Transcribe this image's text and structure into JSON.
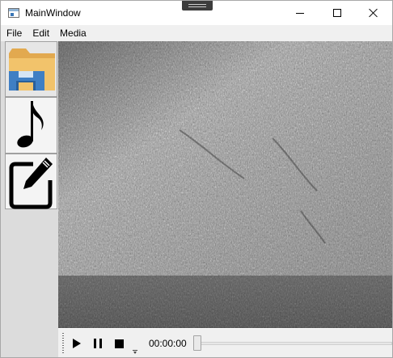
{
  "window": {
    "title": "MainWindow"
  },
  "menubar": {
    "items": [
      {
        "label": "File"
      },
      {
        "label": "Edit"
      },
      {
        "label": "Media"
      }
    ]
  },
  "sidebar": {
    "buttons": [
      {
        "icon": "folder-save-icon"
      },
      {
        "icon": "music-note-icon"
      },
      {
        "icon": "edit-pencil-icon"
      }
    ]
  },
  "player": {
    "time": "00:00:00",
    "progress": 0
  },
  "colors": {
    "folder": "#f2c36b",
    "disk_blue": "#3f7fc4",
    "sidebar_bg": "#dcdcdc",
    "menubar_bg": "#f0f0f0"
  }
}
